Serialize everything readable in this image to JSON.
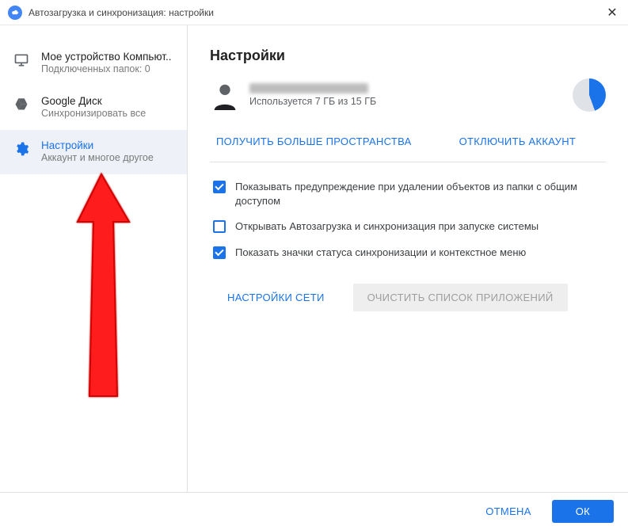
{
  "titlebar": {
    "title": "Автозагрузка и синхронизация: настройки"
  },
  "sidebar": {
    "items": [
      {
        "title": "Мое устройство Компьют..",
        "sub": "Подключенных папок: 0",
        "icon": "monitor-icon",
        "active": false
      },
      {
        "title": "Google Диск",
        "sub": "Синхронизировать все",
        "icon": "drive-icon",
        "active": false
      },
      {
        "title": "Настройки",
        "sub": "Аккаунт и многое другое",
        "icon": "gear-icon",
        "active": true
      }
    ]
  },
  "main": {
    "heading": "Настройки",
    "storage_text": "Используется 7 ГБ из 15 ГБ",
    "links": {
      "more_space": "ПОЛУЧИТЬ БОЛЬШЕ ПРОСТРАНСТВА",
      "disconnect": "ОТКЛЮЧИТЬ АККАУНТ"
    },
    "checks": [
      {
        "label": "Показывать предупреждение при удалении объектов из папки с общим доступом",
        "checked": true
      },
      {
        "label": "Открывать Автозагрузка и синхронизация при запуске системы",
        "checked": false
      },
      {
        "label": "Показать значки статуса синхронизации и контекстное меню",
        "checked": true
      }
    ],
    "network_btn": "НАСТРОЙКИ СЕТИ",
    "clear_apps_btn": "ОЧИСТИТЬ СПИСОК ПРИЛОЖЕНИЙ"
  },
  "footer": {
    "cancel": "ОТМЕНА",
    "ok": "ОК"
  }
}
